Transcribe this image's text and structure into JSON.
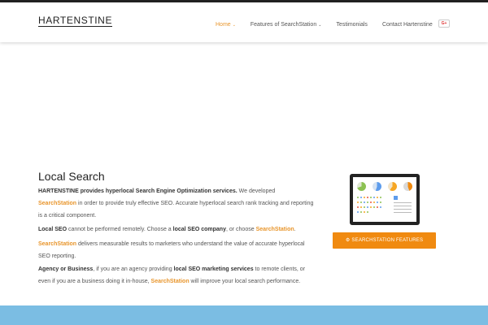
{
  "header": {
    "logo": "HARTENSTINE",
    "nav": [
      {
        "label": "Home",
        "caret": "⌄"
      },
      {
        "label": "Features of SearchStation",
        "caret": "⌄"
      },
      {
        "label": "Testimonials"
      },
      {
        "label": "Contact Hartenstine"
      }
    ],
    "social": "G+"
  },
  "content": {
    "title": "Local Search",
    "p1": {
      "strong": "HARTENSTINE provides hyperlocal Search Engine Optimization services.",
      "t1": " We developed ",
      "link": "SearchStation",
      "t2": " in order to provide truly effective SEO. Accurate hyperlocal search rank tracking and reporting is a critical component."
    },
    "p2": {
      "strong1": "Local SEO",
      "t1": " cannot be performed remotely. Choose a ",
      "strong2": "local SEO company",
      "t2": ", or choose ",
      "link": "SearchStation",
      "t3": "."
    },
    "p3": {
      "link": "SearchStation",
      "t1": " delivers measurable results to marketers who understand the value of accurate hyperlocal SEO reporting."
    },
    "p4": {
      "strong1": "Agency or Business",
      "t1": ", if you are an agency providing ",
      "strong2": "local SEO marketing services",
      "t2": " to remote clients, or even if you are a business doing it in-house, ",
      "link": "SearchStation",
      "t3": " will improve your local search performance."
    }
  },
  "cta": {
    "label": "SEARCHSTATION FEATURES",
    "icon": "⚙"
  },
  "colors": {
    "accent": "#e8952b",
    "button": "#f08a10",
    "footer": "#7bbde3"
  }
}
